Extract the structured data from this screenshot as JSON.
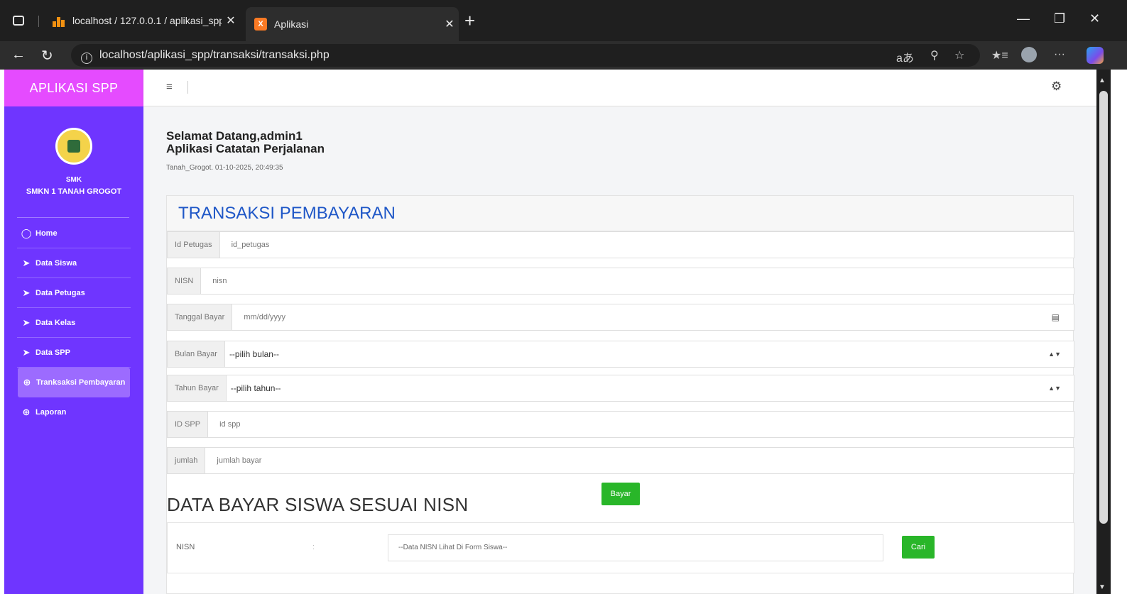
{
  "browser": {
    "tabs": [
      {
        "title": "localhost / 127.0.0.1 / aplikasi_spp",
        "close": "✕"
      },
      {
        "title": "Aplikasi",
        "close": "✕"
      }
    ],
    "favicon_xampp": "X",
    "new_tab": "+",
    "url": "localhost/aplikasi_spp/transaksi/transaksi.php",
    "read_aloud_glyph": "aあ",
    "more_glyph": "···"
  },
  "sidebar": {
    "brand": "APLIKASI SPP",
    "school_sub": "SMK",
    "school_name": "SMKN 1 TANAH GROGOT",
    "items": [
      {
        "label": "Home",
        "icon": "home-icon"
      },
      {
        "label": "Data Siswa",
        "icon": "send-icon"
      },
      {
        "label": "Data Petugas",
        "icon": "send-icon"
      },
      {
        "label": "Data Kelas",
        "icon": "send-icon"
      },
      {
        "label": "Data SPP",
        "icon": "send-icon"
      },
      {
        "label": "Tranksaksi Pembayaran",
        "icon": "plus-circle-icon",
        "active": true
      },
      {
        "label": "Laporan",
        "icon": "plus-circle-icon"
      }
    ]
  },
  "header": {
    "welcome_line1": "Selamat Datang,admin1",
    "welcome_line2": "Aplikasi Catatan Perjalanan",
    "datetime": "Tanah_Grogot. 01-10-2025, 20:49:35"
  },
  "form": {
    "title": "TRANSAKSI PEMBAYARAN",
    "id_petugas": {
      "label": "Id Petugas",
      "placeholder": "id_petugas"
    },
    "nisn": {
      "label": "NISN",
      "placeholder": "nisn"
    },
    "tanggal_bayar": {
      "label": "Tanggal Bayar",
      "placeholder": "mm/dd/yyyy"
    },
    "bulan_bayar": {
      "label": "Bulan Bayar",
      "selected": "--pilih bulan--"
    },
    "tahun_bayar": {
      "label": "Tahun Bayar",
      "selected": "--pilih tahun--"
    },
    "id_spp": {
      "label": "ID SPP",
      "placeholder": "id spp"
    },
    "jumlah": {
      "label": "jumlah",
      "placeholder": "jumlah bayar"
    },
    "submit_label": "Bayar"
  },
  "search_section": {
    "title": "DATA BAYAR SISWA SESUAI NISN",
    "label": "NISN",
    "colon": ":",
    "placeholder": "--Data NISN Lihat Di Form Siswa--",
    "button_label": "Cari"
  },
  "colors": {
    "sidebar": "#6f35ff",
    "brand": "#e54bff",
    "active_item": "#9c6bff",
    "title_blue": "#1f57c7",
    "button_green": "#29b629"
  }
}
